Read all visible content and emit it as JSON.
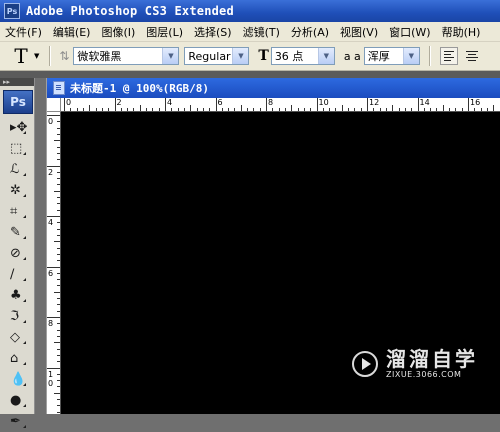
{
  "titlebar": {
    "logo": "Ps",
    "title": "Adobe Photoshop CS3 Extended"
  },
  "menu": [
    "文件(F)",
    "编辑(E)",
    "图像(I)",
    "图层(L)",
    "选择(S)",
    "滤镜(T)",
    "分析(A)",
    "视图(V)",
    "窗口(W)",
    "帮助(H)"
  ],
  "options": {
    "tool_glyph": "T",
    "font_family": "微软雅黑",
    "font_style": "Regular",
    "font_size": "36 点",
    "aa_label": "a a",
    "aa_mode": "浑厚"
  },
  "toolbox": {
    "logo": "Ps",
    "tools": [
      {
        "name": "move-tool-icon",
        "glyph": "▸✥"
      },
      {
        "name": "marquee-tool-icon",
        "glyph": "⬚"
      },
      {
        "name": "lasso-tool-icon",
        "glyph": "ℒ"
      },
      {
        "name": "magic-wand-tool-icon",
        "glyph": "✲"
      },
      {
        "name": "crop-tool-icon",
        "glyph": "⌗"
      },
      {
        "name": "slice-tool-icon",
        "glyph": "✎"
      },
      {
        "name": "healing-brush-tool-icon",
        "glyph": "⊘"
      },
      {
        "name": "brush-tool-icon",
        "glyph": "∕"
      },
      {
        "name": "clone-stamp-tool-icon",
        "glyph": "♣"
      },
      {
        "name": "history-brush-tool-icon",
        "glyph": "ℑ"
      },
      {
        "name": "eraser-tool-icon",
        "glyph": "◇"
      },
      {
        "name": "paint-bucket-tool-icon",
        "glyph": "⌂"
      },
      {
        "name": "blur-tool-icon",
        "glyph": "💧"
      },
      {
        "name": "dodge-tool-icon",
        "glyph": "●"
      },
      {
        "name": "pen-tool-icon",
        "glyph": "✒"
      }
    ]
  },
  "document": {
    "title": "未标题-1 @ 100%(RGB/8)",
    "ruler_h_labels": [
      "0",
      "2",
      "4",
      "6",
      "8",
      "10",
      "12",
      "14",
      "16"
    ],
    "ruler_v_labels": [
      "0",
      "2",
      "4",
      "6",
      "8",
      "1\n0"
    ],
    "canvas_color": "#000000"
  },
  "watermark": {
    "name": "溜溜自学",
    "url": "ZIXUE.3066.COM"
  }
}
